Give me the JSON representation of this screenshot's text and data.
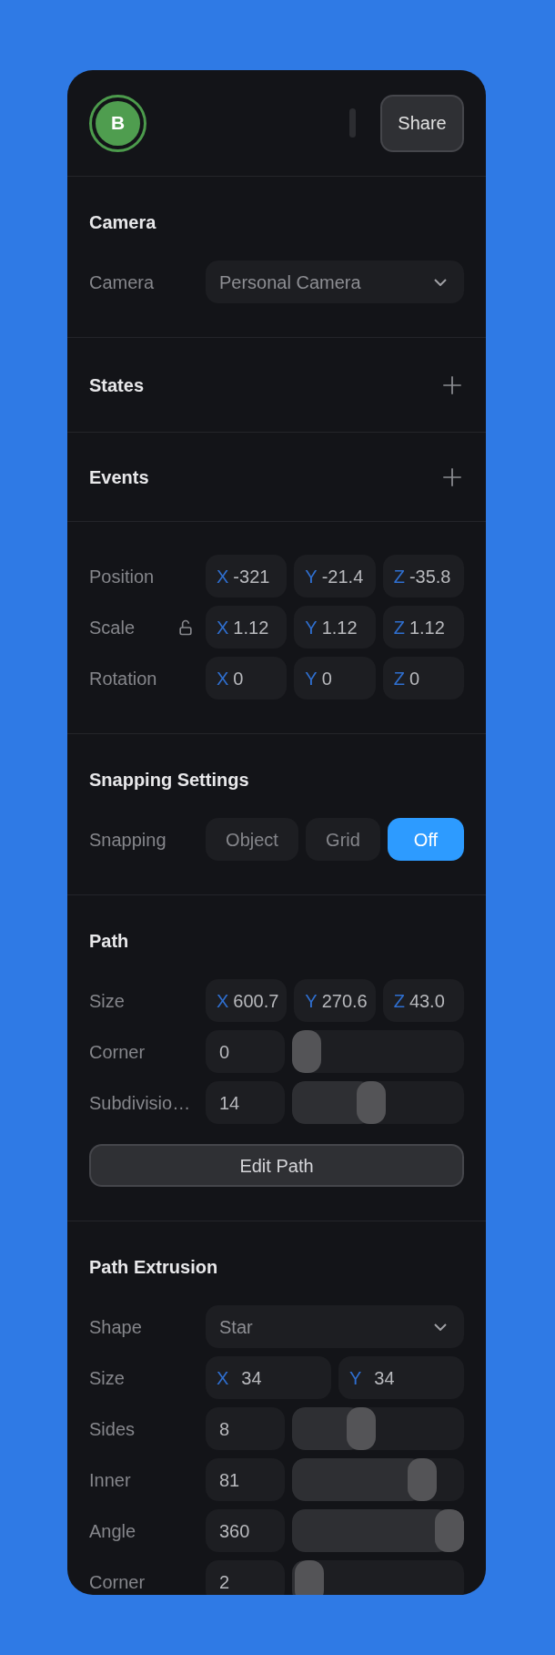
{
  "header": {
    "avatar": "B",
    "share_button": "Share"
  },
  "sections": [
    {
      "kind": "panel",
      "title": "Camera",
      "rows": [
        {
          "kind": "select",
          "label": "Camera",
          "value": "Personal Camera"
        }
      ]
    },
    {
      "kind": "add",
      "title": "States"
    },
    {
      "kind": "add",
      "title": "Events"
    },
    {
      "kind": "panel",
      "rows": [
        {
          "kind": "xyz",
          "label": "Position",
          "fields": [
            {
              "axis": "X",
              "value": "-321"
            },
            {
              "axis": "Y",
              "value": "-21.4"
            },
            {
              "axis": "Z",
              "value": "-35.8"
            }
          ]
        },
        {
          "kind": "xyz",
          "label": "Scale",
          "lock": {
            "locked": false
          },
          "fields": [
            {
              "axis": "X",
              "value": "1.12"
            },
            {
              "axis": "Y",
              "value": "1.12"
            },
            {
              "axis": "Z",
              "value": "1.12"
            }
          ]
        },
        {
          "kind": "xyz",
          "label": "Rotation",
          "fields": [
            {
              "axis": "X",
              "value": "0"
            },
            {
              "axis": "Y",
              "value": "0"
            },
            {
              "axis": "Z",
              "value": "0"
            }
          ]
        }
      ]
    },
    {
      "kind": "panel",
      "title": "Snapping Settings",
      "rows": [
        {
          "kind": "segmented",
          "label": "Snapping",
          "options": [
            {
              "label": "Object",
              "selected": false
            },
            {
              "label": "Grid",
              "selected": false
            },
            {
              "label": "Off",
              "selected": true
            }
          ]
        }
      ]
    },
    {
      "kind": "panel",
      "title": "Path",
      "rows": [
        {
          "kind": "xyz",
          "label": "Size",
          "fields": [
            {
              "axis": "X",
              "value": "600.7"
            },
            {
              "axis": "Y",
              "value": "270.6"
            },
            {
              "axis": "Z",
              "value": "43.0"
            }
          ]
        },
        {
          "kind": "slider",
          "label": "Corner",
          "value": "0",
          "level": 0
        },
        {
          "kind": "slider",
          "label": "Subdivisio…",
          "value": "14",
          "level": 0.45
        },
        {
          "kind": "button",
          "label": "Edit Path"
        }
      ]
    },
    {
      "kind": "panel",
      "title": "Path Extrusion",
      "rows": [
        {
          "kind": "select",
          "label": "Shape",
          "value": "Star"
        },
        {
          "kind": "xy",
          "label": "Size",
          "fields": [
            {
              "axis": "X",
              "value": "34"
            },
            {
              "axis": "Y",
              "value": "34"
            }
          ]
        },
        {
          "kind": "slider",
          "label": "Sides",
          "value": "8",
          "level": 0.38
        },
        {
          "kind": "slider",
          "label": "Inner",
          "value": "81",
          "level": 0.81
        },
        {
          "kind": "slider",
          "label": "Angle",
          "value": "360",
          "level": 1
        },
        {
          "kind": "slider",
          "label": "Corner",
          "value": "2",
          "level": 0.02
        }
      ]
    }
  ]
}
